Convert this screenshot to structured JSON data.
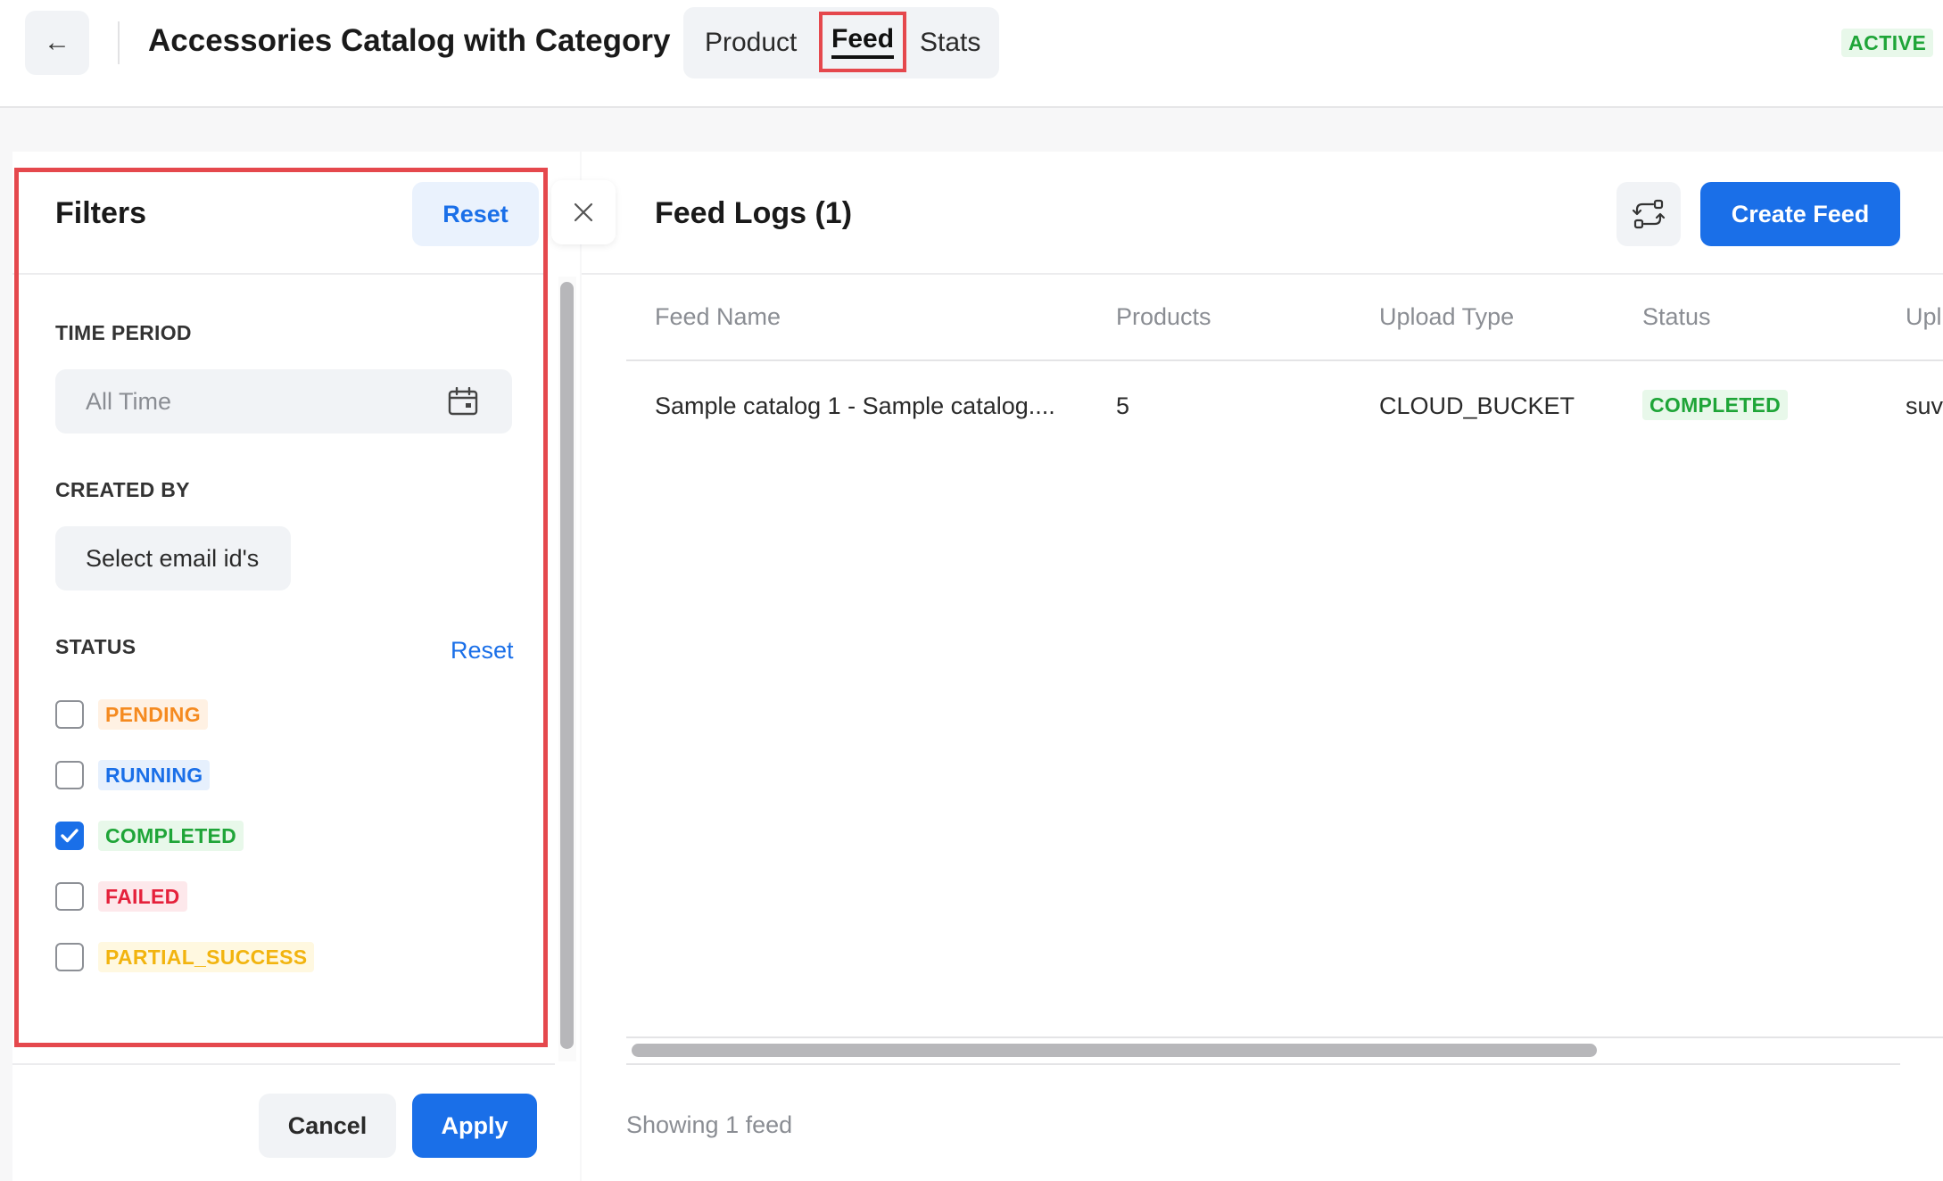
{
  "header": {
    "back_icon": "←",
    "title": "Accessories Catalog with Category",
    "tabs": [
      {
        "label": "Product"
      },
      {
        "label": "Feed"
      },
      {
        "label": "Stats"
      }
    ],
    "status_badge": "ACTIVE"
  },
  "filters": {
    "title": "Filters",
    "reset_label": "Reset",
    "time_period": {
      "label": "TIME PERIOD",
      "value": "All Time"
    },
    "created_by": {
      "label": "CREATED BY",
      "placeholder": "Select email id's"
    },
    "status": {
      "label": "STATUS",
      "reset_label": "Reset",
      "options": [
        {
          "label": "PENDING",
          "checked": false,
          "color": "#f58a1f",
          "bg": "#fff1e3"
        },
        {
          "label": "RUNNING",
          "checked": false,
          "color": "#1a6fe8",
          "bg": "#e6f0fd"
        },
        {
          "label": "COMPLETED",
          "checked": true,
          "color": "#1fa538",
          "bg": "#e8f8ea"
        },
        {
          "label": "FAILED",
          "checked": false,
          "color": "#e5213b",
          "bg": "#fde8eb"
        },
        {
          "label": "PARTIAL_SUCCESS",
          "checked": false,
          "color": "#f2b40f",
          "bg": "#fff8e0"
        }
      ]
    },
    "cancel_label": "Cancel",
    "apply_label": "Apply"
  },
  "logs": {
    "title": "Feed Logs (1)",
    "create_label": "Create Feed",
    "columns": [
      "Feed Name",
      "Products",
      "Upload Type",
      "Status",
      "Upl"
    ],
    "rows": [
      {
        "name": "Sample catalog 1 - Sample catalog....",
        "products": "5",
        "upload_type": "CLOUD_BUCKET",
        "status": "COMPLETED",
        "uploaded_by": "suv"
      }
    ],
    "footer": "Showing 1 feed"
  },
  "colors": {
    "primary": "#1a6fe8",
    "highlight": "#e5484d",
    "success": "#1fa538"
  }
}
